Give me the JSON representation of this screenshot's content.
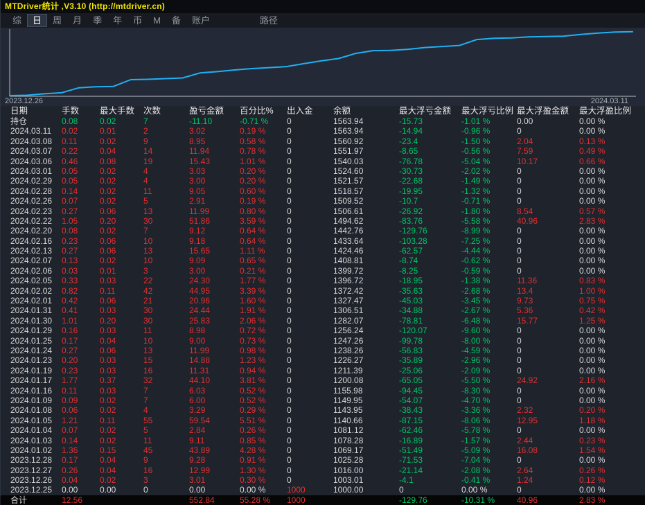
{
  "window": {
    "title": "MTDriver统计 ,V3.10 (http://mtdriver.cn)"
  },
  "menu": {
    "items": [
      {
        "id": "zong",
        "label": "综",
        "active": false,
        "gap": false
      },
      {
        "id": "ri",
        "label": "日",
        "active": true,
        "gap": false
      },
      {
        "id": "zhou",
        "label": "周",
        "active": false,
        "gap": false
      },
      {
        "id": "yue",
        "label": "月",
        "active": false,
        "gap": false
      },
      {
        "id": "ji",
        "label": "季",
        "active": false,
        "gap": false
      },
      {
        "id": "nian",
        "label": "年",
        "active": false,
        "gap": false
      },
      {
        "id": "bi",
        "label": "币",
        "active": false,
        "gap": false
      },
      {
        "id": "m",
        "label": "M",
        "active": false,
        "gap": false
      },
      {
        "id": "bei",
        "label": "备",
        "active": false,
        "gap": false
      },
      {
        "id": "zhanghu",
        "label": "账户",
        "active": false,
        "gap": false
      },
      {
        "id": "lujing",
        "label": "路径",
        "active": false,
        "gap": true
      }
    ]
  },
  "chart": {
    "start_label": "2023.12.26",
    "end_label": "2024.03.11",
    "line_color": "#1fb1f3",
    "axis_color": "#b9bdc2"
  },
  "chart_data": {
    "type": "line",
    "title": "账户余额曲线 (equity curve)",
    "xlabel": "日期",
    "ylabel": "余额",
    "ylim": [
      1000,
      1575
    ],
    "grid": false,
    "legend": "none",
    "x": [
      "2023.12.25",
      "2023.12.26",
      "2023.12.27",
      "2023.12.28",
      "2024.01.02",
      "2024.01.03",
      "2024.01.04",
      "2024.01.05",
      "2024.01.08",
      "2024.01.09",
      "2024.01.16",
      "2024.01.17",
      "2024.01.19",
      "2024.01.23",
      "2024.01.24",
      "2024.01.25",
      "2024.01.29",
      "2024.01.30",
      "2024.01.31",
      "2024.02.01",
      "2024.02.02",
      "2024.02.05",
      "2024.02.06",
      "2024.02.07",
      "2024.02.13",
      "2024.02.16",
      "2024.02.20",
      "2024.02.22",
      "2024.02.23",
      "2024.02.26",
      "2024.02.28",
      "2024.02.29",
      "2024.03.01",
      "2024.03.06",
      "2024.03.07",
      "2024.03.08",
      "2024.03.11"
    ],
    "series": [
      {
        "name": "余额",
        "values": [
          1000.0,
          1003.01,
          1016.0,
          1025.28,
          1069.17,
          1078.28,
          1081.12,
          1140.66,
          1143.95,
          1149.95,
          1155.98,
          1200.08,
          1211.39,
          1226.27,
          1238.26,
          1247.26,
          1256.24,
          1282.07,
          1306.51,
          1327.47,
          1372.42,
          1396.72,
          1399.72,
          1408.81,
          1424.46,
          1433.64,
          1442.76,
          1494.62,
          1506.61,
          1509.52,
          1518.57,
          1521.57,
          1524.6,
          1540.03,
          1551.97,
          1560.92,
          1563.94
        ]
      }
    ]
  },
  "table": {
    "column_keys": [
      "date",
      "lots",
      "max-lots",
      "count",
      "pnl",
      "pct",
      "cashflow",
      "balance",
      "max-float-loss",
      "max-float-loss-pct",
      "max-float-profit",
      "max-float-profit-pct"
    ],
    "columns": [
      "日期",
      "手数",
      "最大手数",
      "次数",
      "盈亏金额",
      "百分比%",
      "出入金",
      "余额",
      "最大浮亏金额",
      "最大浮亏比例",
      "最大浮盈金额",
      "最大浮盈比例"
    ],
    "rows": [
      {
        "type": "position",
        "cells": [
          "持仓",
          "0.08",
          "0.02",
          "7",
          "-11.10",
          "-0.71 %",
          "0",
          "1563.94",
          "-15.73",
          "-1.01 %",
          "0.00",
          "0.00 %"
        ]
      },
      {
        "type": "date",
        "cells": [
          "2024.03.11",
          "0.02",
          "0.01",
          "2",
          "3.02",
          "0.19 %",
          "0",
          "1563.94",
          "-14.94",
          "-0.96 %",
          "0",
          "0.00 %"
        ]
      },
      {
        "type": "date",
        "cells": [
          "2024.03.08",
          "0.11",
          "0.02",
          "9",
          "8.95",
          "0.58 %",
          "0",
          "1560.92",
          "-23.4",
          "-1.50 %",
          "2.04",
          "0.13 %"
        ]
      },
      {
        "type": "date",
        "cells": [
          "2024.03.07",
          "0.22",
          "0.04",
          "14",
          "11.94",
          "0.78 %",
          "0",
          "1551.97",
          "-8.65",
          "-0.56 %",
          "7.59",
          "0.49 %"
        ]
      },
      {
        "type": "date",
        "cells": [
          "2024.03.06",
          "0.46",
          "0.08",
          "19",
          "15.43",
          "1.01 %",
          "0",
          "1540.03",
          "-76.78",
          "-5.04 %",
          "10.17",
          "0.66 %"
        ]
      },
      {
        "type": "date",
        "cells": [
          "2024.03.01",
          "0.05",
          "0.02",
          "4",
          "3.03",
          "0.20 %",
          "0",
          "1524.60",
          "-30.73",
          "-2.02 %",
          "0",
          "0.00 %"
        ]
      },
      {
        "type": "date",
        "cells": [
          "2024.02.29",
          "0.05",
          "0.02",
          "4",
          "3.00",
          "0.20 %",
          "0",
          "1521.57",
          "-22.68",
          "-1.49 %",
          "0",
          "0.00 %"
        ]
      },
      {
        "type": "date",
        "cells": [
          "2024.02.28",
          "0.14",
          "0.02",
          "11",
          "9.05",
          "0.60 %",
          "0",
          "1518.57",
          "-19.95",
          "-1.32 %",
          "0",
          "0.00 %"
        ]
      },
      {
        "type": "date",
        "cells": [
          "2024.02.26",
          "0.07",
          "0.02",
          "5",
          "2.91",
          "0.19 %",
          "0",
          "1509.52",
          "-10.7",
          "-0.71 %",
          "0",
          "0.00 %"
        ]
      },
      {
        "type": "date",
        "cells": [
          "2024.02.23",
          "0.27",
          "0.06",
          "13",
          "11.99",
          "0.80 %",
          "0",
          "1506.61",
          "-26.92",
          "-1.80 %",
          "8.54",
          "0.57 %"
        ]
      },
      {
        "type": "date",
        "cells": [
          "2024.02.22",
          "1.05",
          "0.20",
          "30",
          "51.86",
          "3.59 %",
          "0",
          "1494.62",
          "-83.76",
          "-5.58 %",
          "40.96",
          "2.83 %"
        ]
      },
      {
        "type": "date",
        "cells": [
          "2024.02.20",
          "0.08",
          "0.02",
          "7",
          "9.12",
          "0.64 %",
          "0",
          "1442.76",
          "-129.76",
          "-8.99 %",
          "0",
          "0.00 %"
        ]
      },
      {
        "type": "date",
        "cells": [
          "2024.02.16",
          "0.23",
          "0.06",
          "10",
          "9.18",
          "0.64 %",
          "0",
          "1433.64",
          "-103.28",
          "-7.25 %",
          "0",
          "0.00 %"
        ]
      },
      {
        "type": "date",
        "cells": [
          "2024.02.13",
          "0.27",
          "0.06",
          "13",
          "15.65",
          "1.11 %",
          "0",
          "1424.46",
          "-62.57",
          "-4.44 %",
          "0",
          "0.00 %"
        ]
      },
      {
        "type": "date",
        "cells": [
          "2024.02.07",
          "0.13",
          "0.02",
          "10",
          "9.09",
          "0.65 %",
          "0",
          "1408.81",
          "-8.74",
          "-0.62 %",
          "0",
          "0.00 %"
        ]
      },
      {
        "type": "date",
        "cells": [
          "2024.02.06",
          "0.03",
          "0.01",
          "3",
          "3.00",
          "0.21 %",
          "0",
          "1399.72",
          "-8.25",
          "-0.59 %",
          "0",
          "0.00 %"
        ]
      },
      {
        "type": "date",
        "cells": [
          "2024.02.05",
          "0.33",
          "0.03",
          "22",
          "24.30",
          "1.77 %",
          "0",
          "1396.72",
          "-18.95",
          "-1.38 %",
          "11.36",
          "0.83 %"
        ]
      },
      {
        "type": "date",
        "cells": [
          "2024.02.02",
          "0.82",
          "0.11",
          "42",
          "44.95",
          "3.39 %",
          "0",
          "1372.42",
          "-35.63",
          "-2.68 %",
          "13.4",
          "1.00 %"
        ]
      },
      {
        "type": "date",
        "cells": [
          "2024.02.01",
          "0.42",
          "0.06",
          "21",
          "20.96",
          "1.60 %",
          "0",
          "1327.47",
          "-45.03",
          "-3.45 %",
          "9.73",
          "0.75 %"
        ]
      },
      {
        "type": "date",
        "cells": [
          "2024.01.31",
          "0.41",
          "0.03",
          "30",
          "24.44",
          "1.91 %",
          "0",
          "1306.51",
          "-34.88",
          "-2.67 %",
          "5.36",
          "0.42 %"
        ]
      },
      {
        "type": "date",
        "cells": [
          "2024.01.30",
          "1.01",
          "0.20",
          "30",
          "25.83",
          "2.06 %",
          "0",
          "1282.07",
          "-78.81",
          "-6.48 %",
          "15.77",
          "1.25 %"
        ]
      },
      {
        "type": "date",
        "cells": [
          "2024.01.29",
          "0.16",
          "0.03",
          "11",
          "8.98",
          "0.72 %",
          "0",
          "1256.24",
          "-120.07",
          "-9.60 %",
          "0",
          "0.00 %"
        ]
      },
      {
        "type": "date",
        "cells": [
          "2024.01.25",
          "0.17",
          "0.04",
          "10",
          "9.00",
          "0.73 %",
          "0",
          "1247.26",
          "-99.78",
          "-8.00 %",
          "0",
          "0.00 %"
        ]
      },
      {
        "type": "date",
        "cells": [
          "2024.01.24",
          "0.27",
          "0.06",
          "13",
          "11.99",
          "0.98 %",
          "0",
          "1238.26",
          "-56.83",
          "-4.59 %",
          "0",
          "0.00 %"
        ]
      },
      {
        "type": "date",
        "cells": [
          "2024.01.23",
          "0.20",
          "0.03",
          "15",
          "14.88",
          "1.23 %",
          "0",
          "1226.27",
          "-35.89",
          "-2.96 %",
          "0",
          "0.00 %"
        ]
      },
      {
        "type": "date",
        "cells": [
          "2024.01.19",
          "0.23",
          "0.03",
          "16",
          "11.31",
          "0.94 %",
          "0",
          "1211.39",
          "-25.06",
          "-2.09 %",
          "0",
          "0.00 %"
        ]
      },
      {
        "type": "date",
        "cells": [
          "2024.01.17",
          "1.77",
          "0.37",
          "32",
          "44.10",
          "3.81 %",
          "0",
          "1200.08",
          "-65.05",
          "-5.50 %",
          "24.92",
          "2.16 %"
        ]
      },
      {
        "type": "date",
        "cells": [
          "2024.01.16",
          "0.11",
          "0.03",
          "7",
          "6.03",
          "0.52 %",
          "0",
          "1155.98",
          "-94.45",
          "-8.30 %",
          "0",
          "0.00 %"
        ]
      },
      {
        "type": "date",
        "cells": [
          "2024.01.09",
          "0.09",
          "0.02",
          "7",
          "6.00",
          "0.52 %",
          "0",
          "1149.95",
          "-54.07",
          "-4.70 %",
          "0",
          "0.00 %"
        ]
      },
      {
        "type": "date",
        "cells": [
          "2024.01.08",
          "0.06",
          "0.02",
          "4",
          "3.29",
          "0.29 %",
          "0",
          "1143.95",
          "-38.43",
          "-3.36 %",
          "2.32",
          "0.20 %"
        ]
      },
      {
        "type": "date",
        "cells": [
          "2024.01.05",
          "1.21",
          "0.11",
          "55",
          "59.54",
          "5.51 %",
          "0",
          "1140.66",
          "-87.15",
          "-8.06 %",
          "12.95",
          "1.18 %"
        ]
      },
      {
        "type": "date",
        "cells": [
          "2024.01.04",
          "0.07",
          "0.02",
          "5",
          "2.84",
          "0.26 %",
          "0",
          "1081.12",
          "-62.46",
          "-5.78 %",
          "0",
          "0.00 %"
        ]
      },
      {
        "type": "date",
        "cells": [
          "2024.01.03",
          "0.14",
          "0.02",
          "11",
          "9.11",
          "0.85 %",
          "0",
          "1078.28",
          "-16.89",
          "-1.57 %",
          "2.44",
          "0.23 %"
        ]
      },
      {
        "type": "date",
        "cells": [
          "2024.01.02",
          "1.36",
          "0.15",
          "45",
          "43.89",
          "4.28 %",
          "0",
          "1069.17",
          "-51.49",
          "-5.09 %",
          "16.08",
          "1.54 %"
        ]
      },
      {
        "type": "date",
        "cells": [
          "2023.12.28",
          "0.17",
          "0.04",
          "9",
          "9.28",
          "0.91 %",
          "0",
          "1025.28",
          "-71.53",
          "-7.04 %",
          "0",
          "0.00 %"
        ]
      },
      {
        "type": "date",
        "cells": [
          "2023.12.27",
          "0.26",
          "0.04",
          "16",
          "12.99",
          "1.30 %",
          "0",
          "1016.00",
          "-21.14",
          "-2.08 %",
          "2.64",
          "0.26 %"
        ]
      },
      {
        "type": "date",
        "cells": [
          "2023.12.26",
          "0.04",
          "0.02",
          "3",
          "3.01",
          "0.30 %",
          "0",
          "1003.01",
          "-4.1",
          "-0.41 %",
          "1.24",
          "0.12 %"
        ]
      },
      {
        "type": "date",
        "cells": [
          "2023.12.25",
          "0.00",
          "0.00",
          "0",
          "0.00",
          "0.00 %",
          "1000",
          "1000.00",
          "0",
          "0.00 %",
          "0",
          "0.00 %"
        ]
      },
      {
        "type": "total",
        "cells": [
          "合计",
          "12.56",
          "",
          "",
          "552.84",
          "55.28 %",
          "1000",
          "",
          "-129.76",
          "-10.31 %",
          "40.96",
          "2.83 %"
        ]
      }
    ]
  },
  "colors": {
    "gain_red": "#e03232",
    "loss_green": "#00c565",
    "title_yellow": "#f2e600",
    "chart_line": "#1fb1f3"
  }
}
